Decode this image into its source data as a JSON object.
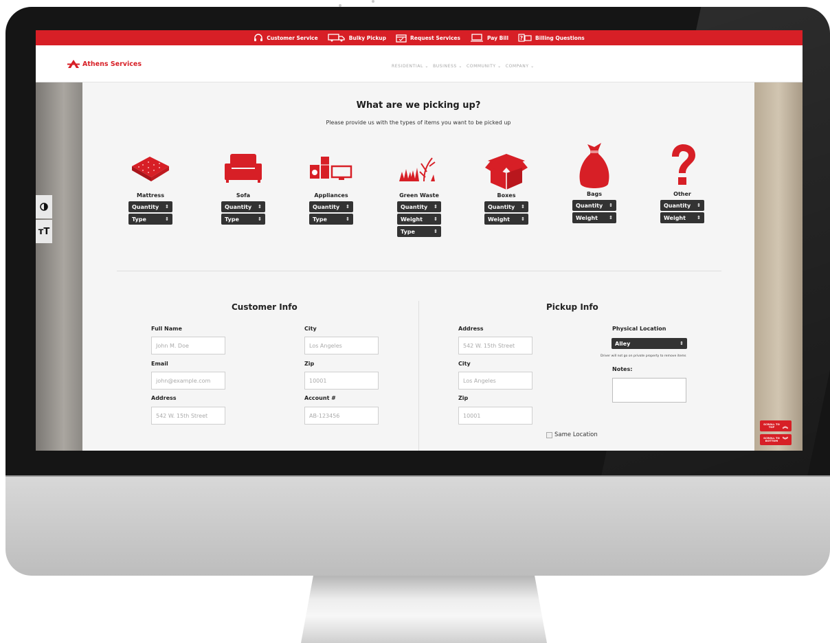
{
  "topbar": {
    "items": [
      {
        "icon": "headset-icon",
        "label": "Customer Service"
      },
      {
        "icon": "truck-icon",
        "label": "Bulky Pickup"
      },
      {
        "icon": "calendar-icon",
        "label": "Request Services"
      },
      {
        "icon": "laptop-icon",
        "label": "Pay Bill"
      },
      {
        "icon": "billing-question-icon",
        "label": "Billing Questions"
      }
    ]
  },
  "brand": {
    "name": "Athens Services"
  },
  "nav": {
    "items": [
      "RESIDENTIAL",
      "BUSINESS",
      "COMMUNITY",
      "COMPANY"
    ]
  },
  "pickup": {
    "title": "What are we picking up?",
    "subtitle": "Please provide us with the types of items you want to be picked up",
    "items": [
      {
        "icon": "mattress-icon",
        "label": "Mattress",
        "selects": [
          "Quantity",
          "Type"
        ]
      },
      {
        "icon": "sofa-icon",
        "label": "Sofa",
        "selects": [
          "Quantity",
          "Type"
        ]
      },
      {
        "icon": "appliances-icon",
        "label": "Appliances",
        "selects": [
          "Quantity",
          "Type"
        ]
      },
      {
        "icon": "green-waste-icon",
        "label": "Green Waste",
        "selects": [
          "Quantity",
          "Weight",
          "Type"
        ]
      },
      {
        "icon": "box-icon",
        "label": "Boxes",
        "selects": [
          "Quantity",
          "Weight"
        ]
      },
      {
        "icon": "bag-icon",
        "label": "Bags",
        "selects": [
          "Quantity",
          "Weight"
        ]
      },
      {
        "icon": "question-icon",
        "label": "Other",
        "selects": [
          "Quantity",
          "Weight"
        ]
      }
    ]
  },
  "customer": {
    "title": "Customer Info",
    "full_name": {
      "label": "Full Name",
      "placeholder": "John M. Doe"
    },
    "email": {
      "label": "Email",
      "placeholder": "john@example.com"
    },
    "address": {
      "label": "Address",
      "placeholder": "542 W. 15th Street"
    },
    "city": {
      "label": "City",
      "placeholder": "Los Angeles"
    },
    "zip": {
      "label": "Zip",
      "placeholder": "10001"
    },
    "account": {
      "label": "Account #",
      "placeholder": "AB-123456"
    }
  },
  "pickup_info": {
    "title": "Pickup Info",
    "address": {
      "label": "Address",
      "placeholder": "542 W. 15th Street"
    },
    "city": {
      "label": "City",
      "placeholder": "Los Angeles"
    },
    "zip": {
      "label": "Zip",
      "placeholder": "10001"
    },
    "physical_location": {
      "label": "Physical Location",
      "value": "Alley",
      "note": "Driver will not go on private property to remove items"
    },
    "notes_label": "Notes:",
    "same_location": "Same Location"
  },
  "accessibility": {
    "contrast_icon": "contrast-icon",
    "text_size_icon": "text-size-icon"
  },
  "scroll": {
    "top": [
      "SCROLL TO",
      "TOP"
    ],
    "bottom": [
      "SCROLL TO",
      "BOTTOM"
    ]
  },
  "colors": {
    "brand_red": "#d71f26",
    "select_bg": "#333333"
  }
}
